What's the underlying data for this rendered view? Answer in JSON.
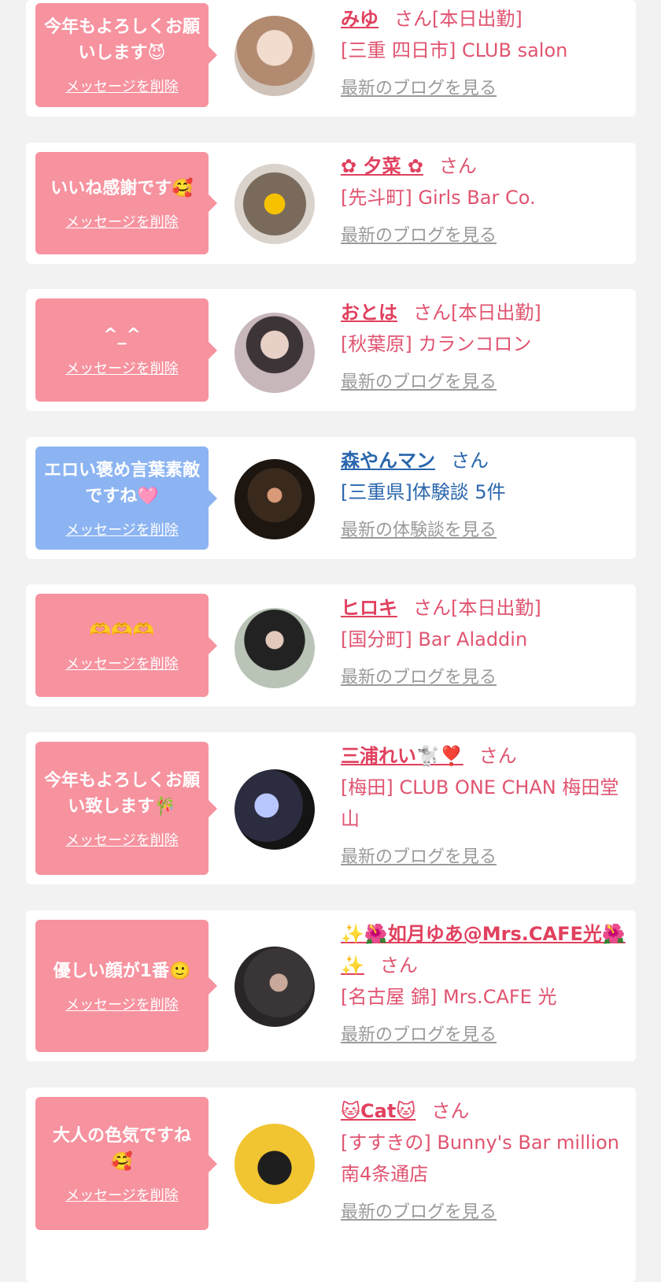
{
  "items": [
    {
      "message": "今年もよろしくお願いします😈",
      "delete_label": "メッセージを削除",
      "name": "みゆ",
      "suffix": "さん[本日出勤]",
      "shop": "[三重 四日市] CLUB salon",
      "blog_link": "最新のブログを見る",
      "theme": "pink"
    },
    {
      "message": "いいね感謝です🥰",
      "delete_label": "メッセージを削除",
      "name": "✿ 夕菜 ✿",
      "suffix": "さん",
      "shop": "[先斗町] Girls Bar Co.",
      "blog_link": "最新のブログを見る",
      "theme": "pink"
    },
    {
      "message": "^_^",
      "delete_label": "メッセージを削除",
      "name": "おとは",
      "suffix": "さん[本日出勤]",
      "shop": "[秋葉原] カランコロン",
      "blog_link": "最新のブログを見る",
      "theme": "pink"
    },
    {
      "message": "エロい褒め言葉素敵ですね🩷",
      "delete_label": "メッセージを削除",
      "name": "森やんマン",
      "suffix": "さん",
      "shop": "[三重県]体験談 5件",
      "blog_link": "最新の体験談を見る",
      "theme": "blue"
    },
    {
      "message": "🫶🫶🫶",
      "delete_label": "メッセージを削除",
      "name": "ヒロキ",
      "suffix": "さん[本日出勤]",
      "shop": "[国分町] Bar Aladdin",
      "blog_link": "最新のブログを見る",
      "theme": "pink"
    },
    {
      "message": "今年もよろしくお願い致します🎋",
      "delete_label": "メッセージを削除",
      "name": "三浦れい🐩❣️",
      "suffix": "さん",
      "shop": "[梅田] CLUB ONE CHAN 梅田堂山",
      "blog_link": "最新のブログを見る",
      "theme": "pink"
    },
    {
      "message": "優しい顔が1番🙂",
      "delete_label": "メッセージを削除",
      "name": "✨🌺如月ゆあ@Mrs.CAFE光🌺✨",
      "suffix": "さん",
      "shop": "[名古屋 錦] Mrs.CAFE 光",
      "blog_link": "最新のブログを見る",
      "theme": "pink"
    },
    {
      "message": "大人の色気ですね🥰",
      "delete_label": "メッセージを削除",
      "name": "🐱Cat🐱",
      "suffix": "さん",
      "shop": "[すすきの] Bunny's Bar million 南4条通店",
      "blog_link": "最新のブログを見る",
      "theme": "pink"
    }
  ],
  "colors": {
    "pink_bubble": "#f7929f",
    "blue_bubble": "#8cb4f2",
    "pink_text": "#e05470",
    "blue_text": "#2a66ad"
  }
}
